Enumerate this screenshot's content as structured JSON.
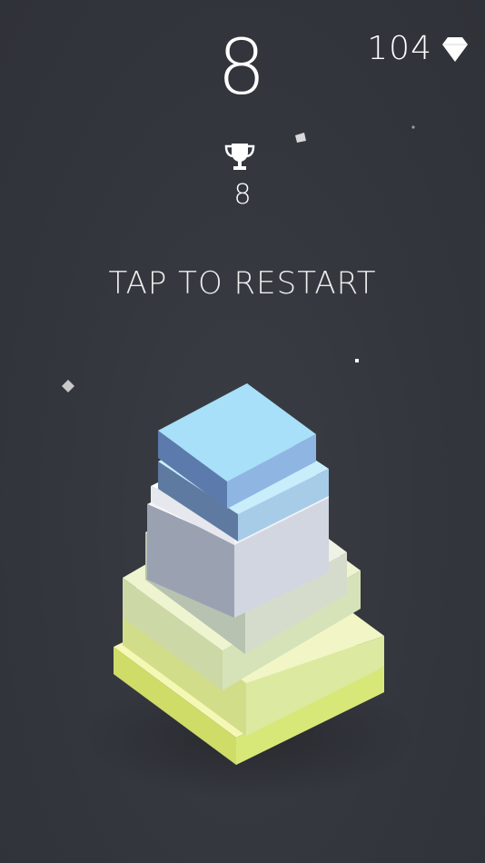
{
  "hud": {
    "score": "8",
    "gems_count": "104",
    "gem_icon": "diamond-icon",
    "trophy_icon": "trophy-icon",
    "best_score": "8"
  },
  "prompt": {
    "restart_text": "TAP TO RESTART"
  },
  "colors": {
    "background": "#33363d",
    "text": "#ffffff",
    "top_block": "#a7e0f8",
    "base_block": "#d8e878"
  }
}
